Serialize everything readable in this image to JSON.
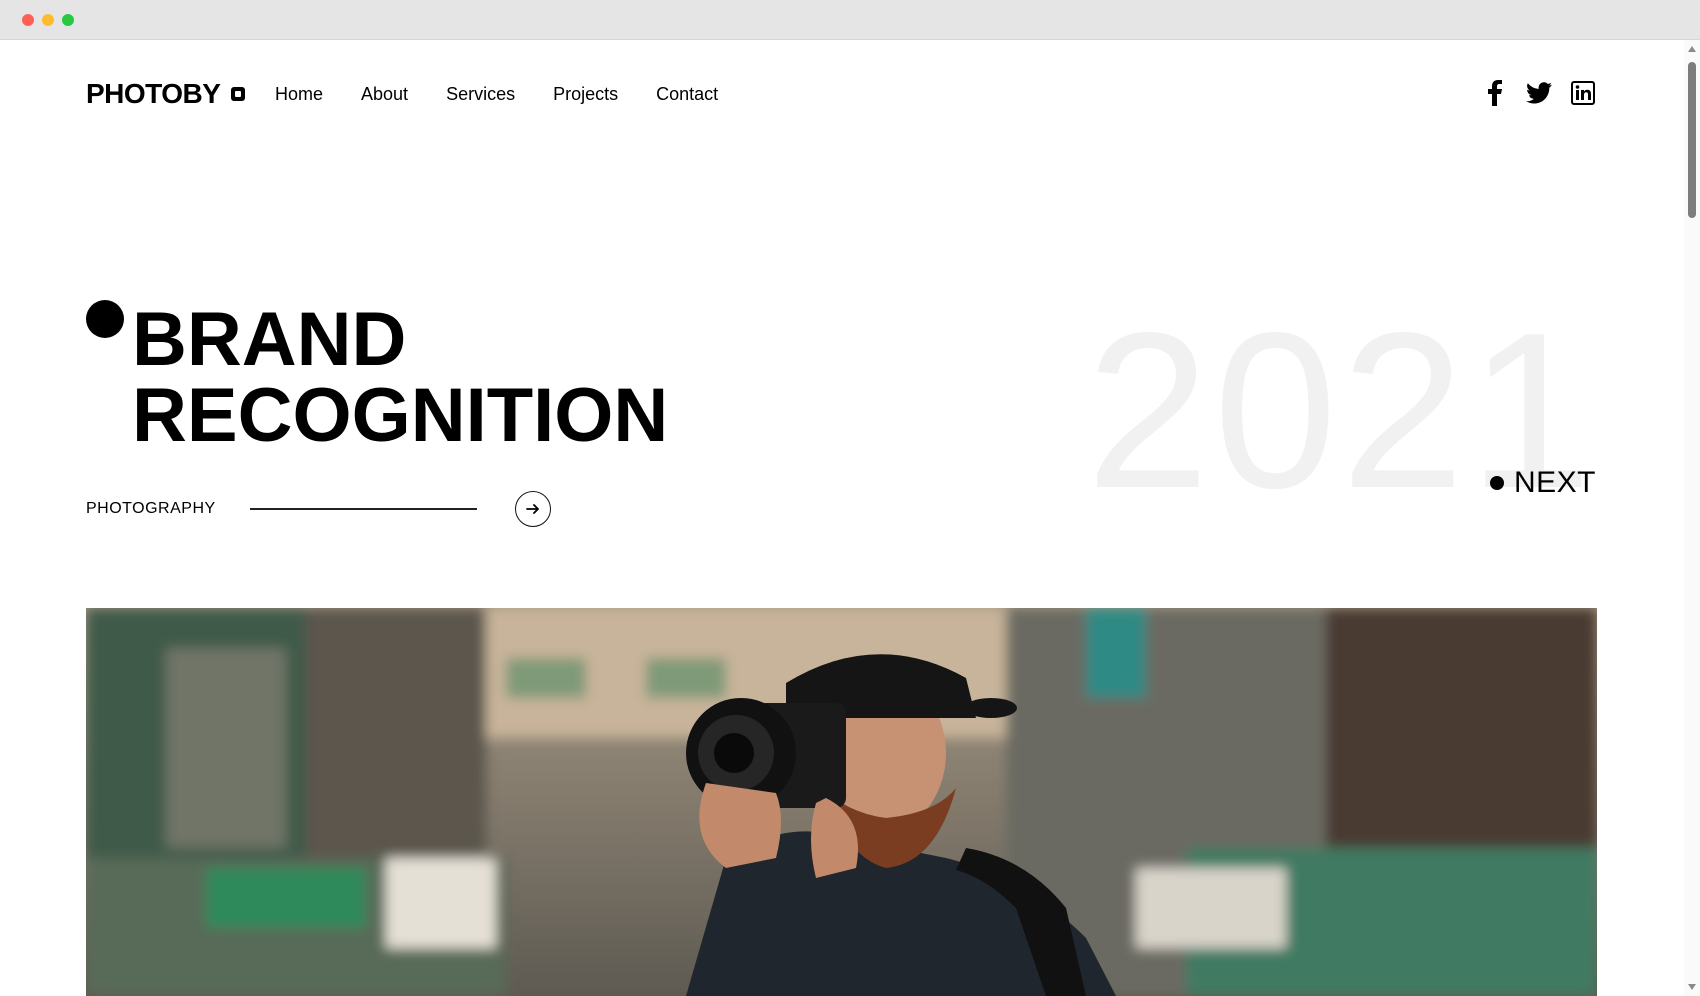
{
  "window": {
    "title": ""
  },
  "brand": {
    "name": "PHOTOBY"
  },
  "nav": {
    "items": [
      {
        "label": "Home"
      },
      {
        "label": "About"
      },
      {
        "label": "Services"
      },
      {
        "label": "Projects"
      },
      {
        "label": "Contact"
      }
    ]
  },
  "social": {
    "icons": [
      "facebook-icon",
      "twitter-icon",
      "linkedin-icon"
    ]
  },
  "hero": {
    "title_line1": "BRAND",
    "title_line2": "RECOGNITION",
    "year": "2021",
    "next_label": "NEXT",
    "category": "PHOTOGRAPHY"
  },
  "colors": {
    "text": "#000000",
    "background": "#ffffff",
    "year_watermark": "#f1f1f1"
  }
}
